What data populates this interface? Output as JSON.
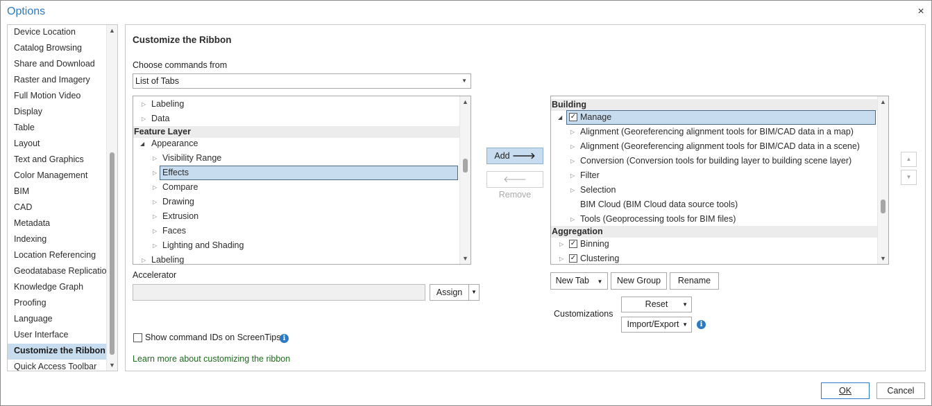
{
  "window": {
    "title": "Options",
    "close_icon": "×"
  },
  "sidebar": {
    "items": [
      {
        "label": "Device Location"
      },
      {
        "label": "Catalog Browsing"
      },
      {
        "label": "Share and Download"
      },
      {
        "label": "Raster and Imagery"
      },
      {
        "label": "Full Motion Video"
      },
      {
        "label": "Display"
      },
      {
        "label": "Table"
      },
      {
        "label": "Layout"
      },
      {
        "label": "Text and Graphics"
      },
      {
        "label": "Color Management"
      },
      {
        "label": "BIM"
      },
      {
        "label": "CAD"
      },
      {
        "label": "Metadata"
      },
      {
        "label": "Indexing"
      },
      {
        "label": "Location Referencing"
      },
      {
        "label": "Geodatabase Replication"
      },
      {
        "label": "Knowledge Graph"
      },
      {
        "label": "Proofing"
      },
      {
        "label": "Language"
      },
      {
        "label": "User Interface"
      },
      {
        "label": "Customize the Ribbon",
        "selected": true
      },
      {
        "label": "Quick Access Toolbar"
      }
    ]
  },
  "main": {
    "title": "Customize the Ribbon",
    "choose_label": "Choose commands from",
    "choose_value": "List of Tabs",
    "commands_tree": [
      {
        "label": "Labeling"
      },
      {
        "label": "Data"
      },
      {
        "label": "Feature Layer"
      },
      {
        "label": "Appearance"
      },
      {
        "label": "Visibility Range"
      },
      {
        "label": "Effects",
        "selected": true
      },
      {
        "label": "Compare"
      },
      {
        "label": "Drawing"
      },
      {
        "label": "Extrusion"
      },
      {
        "label": "Faces"
      },
      {
        "label": "Lighting and Shading"
      },
      {
        "label": "Labeling"
      }
    ],
    "add_label": "Add",
    "remove_label": "Remove",
    "accelerator_label": "Accelerator",
    "accelerator_value": "",
    "assign_label": "Assign",
    "show_ids_label": "Show command IDs on ScreenTips",
    "show_ids_checked": false,
    "learn_more": "Learn more about customizing the ribbon",
    "ribbon_tree": [
      {
        "label": "Building"
      },
      {
        "label": "Manage",
        "checked": true,
        "selected": true
      },
      {
        "label": "Alignment (Georeferencing alignment tools for BIM/CAD data in a map)"
      },
      {
        "label": "Alignment (Georeferencing alignment tools for BIM/CAD data in a scene)"
      },
      {
        "label": "Conversion (Conversion tools for building layer to building scene layer)"
      },
      {
        "label": "Filter"
      },
      {
        "label": "Selection"
      },
      {
        "label": "BIM Cloud (BIM Cloud data source tools)"
      },
      {
        "label": "Tools (Geoprocessing tools for BIM files)"
      },
      {
        "label": "Aggregation"
      },
      {
        "label": "Binning",
        "checked": true
      },
      {
        "label": "Clustering",
        "checked": true
      }
    ],
    "new_tab_label": "New Tab",
    "new_group_label": "New Group",
    "rename_label": "Rename",
    "customizations_label": "Customizations",
    "reset_label": "Reset",
    "import_export_label": "Import/Export"
  },
  "footer": {
    "ok_label": "OK",
    "cancel_label": "Cancel"
  },
  "colors": {
    "accent": "#2a7bc2",
    "selection": "#c7dcee",
    "link": "#1c6b1c"
  }
}
